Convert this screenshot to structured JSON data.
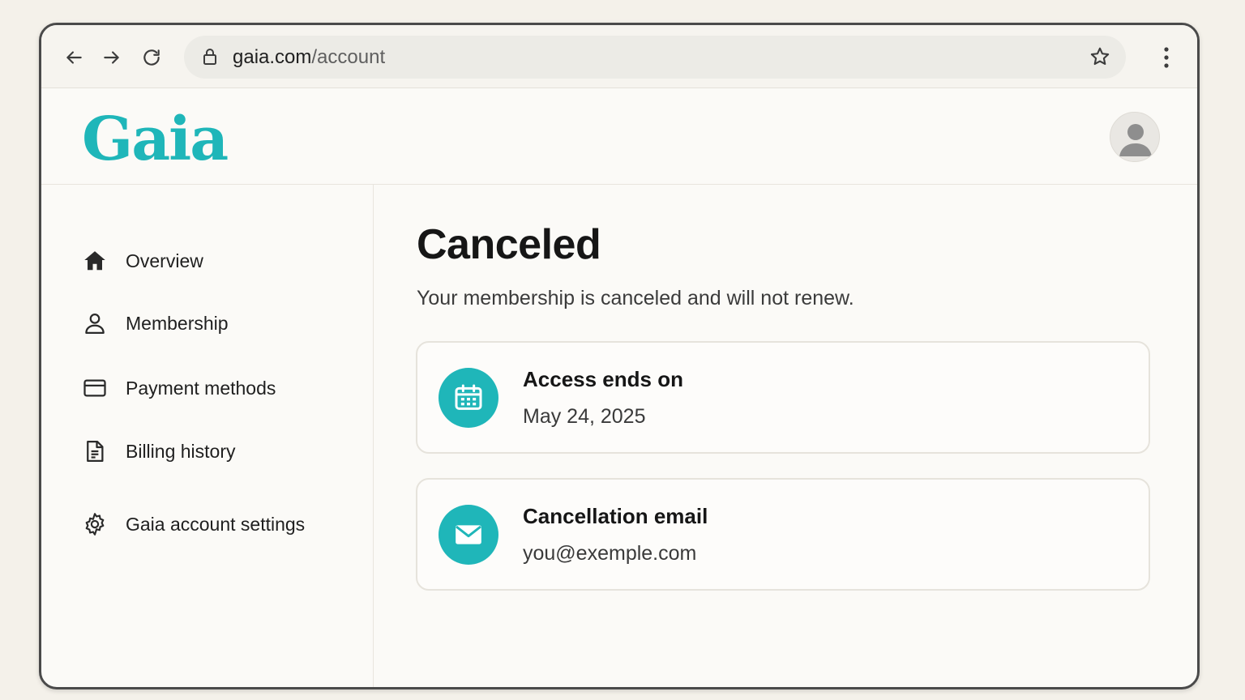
{
  "browser": {
    "url_domain": "gaia.com",
    "url_path": "/account"
  },
  "site": {
    "logo": "Gaia"
  },
  "sidebar": {
    "items": [
      {
        "label": "Overview",
        "icon": "home-icon"
      },
      {
        "label": "Membership",
        "icon": "person-icon"
      },
      {
        "label": "Payment methods",
        "icon": "credit-card-icon"
      },
      {
        "label": "Billing history",
        "icon": "document-icon"
      },
      {
        "label": "Gaia account settings",
        "icon": "gear-icon"
      }
    ]
  },
  "main": {
    "title": "Canceled",
    "subtitle": "Your membership is canceled and will not renew.",
    "cards": [
      {
        "title": "Access ends on",
        "value": "May 24, 2025",
        "icon": "calendar-icon"
      },
      {
        "title": "Cancellation email",
        "value": "you@exemple.com",
        "icon": "mail-icon"
      }
    ]
  },
  "colors": {
    "accent": "#1fb6b9",
    "background": "#f4f1ea",
    "page": "#fbfaf7"
  }
}
